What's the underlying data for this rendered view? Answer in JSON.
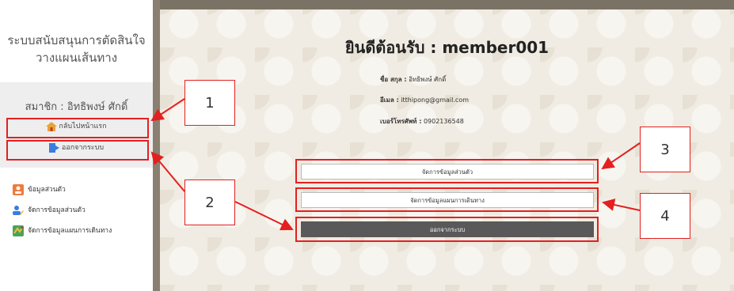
{
  "sidebar": {
    "title_line1": "ระบบสนับสนุนการตัดสินใจ",
    "title_line2": "วางแผนเส้นทาง",
    "member_label": "สมาชิก : อิทธิพงษ์ ศักดิ์",
    "home_link": "กลับไปหน้าแรก",
    "logout_link": "ออกจากระบบ",
    "menu": [
      {
        "label": "ข้อมูลส่วนตัว",
        "icon": "user-icon"
      },
      {
        "label": "จัดการข้อมูลส่วนตัว",
        "icon": "edit-user-icon"
      },
      {
        "label": "จัดการข้อมูลแผนการเดินทาง",
        "icon": "map-icon"
      }
    ]
  },
  "main": {
    "welcome": "ยินดีต้อนรับ : member001",
    "name_label": "ชื่อ สกุล :",
    "name_value": "อิทธิพงษ์ ศักดิ์",
    "email_label": "อีเมล :",
    "email_value": "itthipong@gmail.com",
    "phone_label": "เบอร์โทรศัพท์ :",
    "phone_value": "0902136548",
    "buttons": {
      "manage_profile": "จัดการข้อมูลส่วนตัว",
      "manage_plan": "จัดการข้อมูลแผนการเดินทาง",
      "logout": "ออกจากระบบ"
    }
  },
  "callouts": [
    "1",
    "2",
    "3",
    "4"
  ],
  "colors": {
    "annotation": "#e32020",
    "logout_button": "#595959",
    "background": "#f1ece3"
  }
}
